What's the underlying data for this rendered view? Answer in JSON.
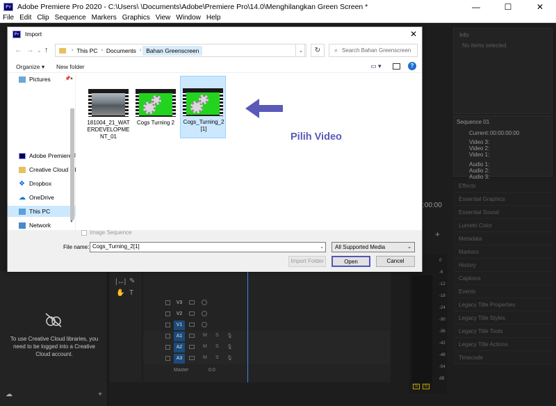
{
  "app": {
    "title": "Adobe Premiere Pro 2020 - C:\\Users\\        \\Documents\\Adobe\\Premiere Pro\\14.0\\Menghilangkan Green Screen *",
    "logo_text": "Pr",
    "window_controls": [
      "—",
      "☐",
      "✕"
    ],
    "menu": [
      "File",
      "Edit",
      "Clip",
      "Sequence",
      "Markers",
      "Graphics",
      "View",
      "Window",
      "Help"
    ]
  },
  "dialog": {
    "title": "Import",
    "logo_text": "Pr",
    "close": "✕",
    "breadcrumbs": [
      "This PC",
      "Documents",
      "Bahan Greenscreen"
    ],
    "search_placeholder": "Search Bahan Greenscreen",
    "organize": "Organize ▾",
    "new_folder": "New folder",
    "nav_items": [
      {
        "label": "Pictures",
        "icon": "pictures-icon"
      },
      {
        "label": "Adobe Premiere P",
        "icon": "premiere-icon"
      },
      {
        "label": "Creative Cloud Fil",
        "icon": "creative-cloud-icon"
      },
      {
        "label": "Dropbox",
        "icon": "dropbox-icon"
      },
      {
        "label": "OneDrive",
        "icon": "onedrive-icon"
      },
      {
        "label": "This PC",
        "icon": "computer-icon"
      },
      {
        "label": "Network",
        "icon": "network-icon"
      }
    ],
    "files": [
      {
        "name": "181004_21_WATERDEVELOPMENT_01",
        "thumb": "office"
      },
      {
        "name": "Cogs Turning 2",
        "thumb": "green"
      },
      {
        "name": "Cogs_Turning_2[1]",
        "thumb": "green"
      }
    ],
    "image_sequence": "Image Sequence",
    "file_name_label": "File name:",
    "file_name_value": "Cogs_Turning_2[1]",
    "file_type": "All Supported Media",
    "import_folder": "Import Folder",
    "open": "Open",
    "cancel": "Cancel"
  },
  "annotation": {
    "text": "Pilih Video",
    "color": "#5a5ab8"
  },
  "right_panels": {
    "info_title": "Info",
    "info_sub": "No items selected",
    "sequence_title": "Sequence 01",
    "current_label": "Current:",
    "current_value": "00:00:00:00",
    "video_tracks": [
      "Video 3:",
      "Video 2:",
      "Video 1:"
    ],
    "audio_tracks": [
      "Audio 1:",
      "Audio 2:",
      "Audio 3:"
    ],
    "list": [
      "Effects",
      "Essential Graphics",
      "Essential Sound",
      "Lumetri Color",
      "Metadata",
      "Markers",
      "History",
      "Captions",
      "Events",
      "Legacy Title Properties",
      "Legacy Title Styles",
      "Legacy Title Tools",
      "Legacy Title Actions",
      "Timecode"
    ],
    "timecode_stub": ":00:00"
  },
  "libraries": {
    "message": "To use Creative Cloud libraries, you need to be logged into a Creative Cloud account."
  },
  "timeline": {
    "tracks": [
      {
        "name": "V3",
        "active": false,
        "type": "video"
      },
      {
        "name": "V2",
        "active": false,
        "type": "video"
      },
      {
        "name": "V1",
        "active": true,
        "type": "video"
      },
      {
        "name": "A1",
        "active": true,
        "type": "audio"
      },
      {
        "name": "A2",
        "active": true,
        "type": "audio"
      },
      {
        "name": "A3",
        "active": true,
        "type": "audio"
      }
    ],
    "mute_label": "M",
    "solo_label": "S",
    "master_label": "Master",
    "master_value": "0.0"
  },
  "meters": {
    "scale": [
      "0",
      "-6",
      "-12",
      "-18",
      "-24",
      "-30",
      "-36",
      "-42",
      "-48",
      "-54",
      "dB"
    ],
    "solo_buttons": [
      "S",
      "S"
    ]
  },
  "colors": {
    "accent_blue": "#2d8ceb",
    "green_screen": "#22d41e",
    "selection": "#cce8ff"
  }
}
